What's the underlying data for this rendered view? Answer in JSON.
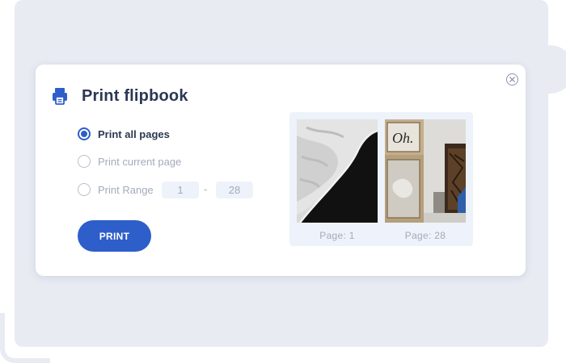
{
  "dialog": {
    "title": "Print flipbook",
    "header_icon": "printer-icon",
    "close_icon": "close-icon"
  },
  "options": {
    "all_pages": {
      "label": "Print all pages",
      "checked": true
    },
    "current_page": {
      "label": "Print current page",
      "checked": false
    },
    "range": {
      "label": "Print Range",
      "checked": false,
      "from": "1",
      "separator": "-",
      "to": "28"
    }
  },
  "actions": {
    "print_label": "PRINT"
  },
  "preview": {
    "left_caption": "Page: 1",
    "right_caption": "Page: 28",
    "right_image_text": "Oh."
  },
  "colors": {
    "accent": "#2e5ec9",
    "title": "#2b3852",
    "muted": "#a3abba",
    "background": "#e8ebf2",
    "input_bg": "#eef2fa"
  }
}
